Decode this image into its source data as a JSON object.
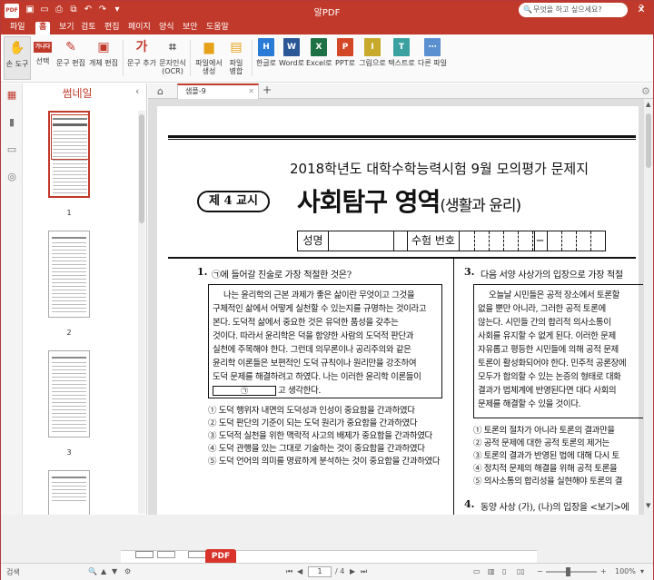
{
  "app": {
    "title": "알PDF",
    "logo": "PDF"
  },
  "window_controls": {
    "minimize": "─",
    "maximize": "☐",
    "close": "✕"
  },
  "quick_access": [
    "save-icon",
    "open-icon",
    "print-icon",
    "copy-icon",
    "undo-icon",
    "redo-icon",
    "dropdown-icon"
  ],
  "menus": [
    {
      "label": "파일",
      "active": false
    },
    {
      "label": "홈",
      "active": true
    },
    {
      "label": "보기",
      "active": false
    },
    {
      "label": "검토",
      "active": false
    },
    {
      "label": "편집",
      "active": false
    },
    {
      "label": "페이지",
      "active": false
    },
    {
      "label": "양식",
      "active": false
    },
    {
      "label": "보안",
      "active": false
    },
    {
      "label": "도움말",
      "active": false
    }
  ],
  "search": {
    "placeholder": "무엇을 하고 싶으세요?"
  },
  "ribbon": {
    "tools": [
      {
        "label": "손 도구",
        "icon": "hand-icon",
        "glyph": "✋",
        "color": "#555555",
        "selected": true
      },
      {
        "label": "선택",
        "icon": "select-icon",
        "glyph": "가나다",
        "color": "#c0392b"
      },
      {
        "label": "문구 편집",
        "icon": "text-edit-icon",
        "glyph": "✎",
        "color": "#c0392b"
      },
      {
        "label": "개체 편집",
        "icon": "object-edit-icon",
        "glyph": "▣",
        "color": "#c0392b"
      },
      {
        "label": "문구 추가",
        "icon": "add-text-icon",
        "glyph": "가",
        "color": "#c0392b"
      },
      {
        "label": "문자인식\n(OCR)",
        "icon": "ocr-icon",
        "glyph": "⌗",
        "color": "#555555"
      },
      {
        "label": "파일에서\n생성",
        "icon": "create-from-file-icon",
        "glyph": "▆",
        "color": "#e6a21a"
      },
      {
        "label": "파일\n병합",
        "icon": "merge-icon",
        "glyph": "▤",
        "color": "#e6a21a"
      }
    ],
    "converts": [
      {
        "label": "한글로",
        "letter": "H",
        "color": "#2a7bd5"
      },
      {
        "label": "Word로",
        "letter": "W",
        "color": "#2b5797"
      },
      {
        "label": "Excel로",
        "letter": "X",
        "color": "#1e7145"
      },
      {
        "label": "PPT로",
        "letter": "P",
        "color": "#d24726"
      },
      {
        "label": "그림으로",
        "letter": "I",
        "color": "#c7a92b"
      },
      {
        "label": "텍스트로",
        "letter": "T",
        "color": "#3aa0a0"
      },
      {
        "label": "다른 파일",
        "letter": "⋯",
        "color": "#5a8fd0"
      }
    ]
  },
  "sidebar": {
    "title": "썸네일",
    "pages": [
      "1",
      "2",
      "3"
    ]
  },
  "tabs": {
    "doc_tab": "샘플-9"
  },
  "document": {
    "exam_title": "2018학년도 대학수학능력시험 9월 모의평가 문제지",
    "session": "제 4 교시",
    "subject": "사회탐구 영역",
    "subject_sub": "(생활과 윤리)",
    "name_label": "성명",
    "id_label": "수험 번호",
    "q1": {
      "num": "1.",
      "text": "㉠에 들어갈 진술로 가장 적절한 것은?",
      "passage": [
        "나는 윤리학의 근본 과제가 좋은 삶이란 무엇이고 그것을",
        "구체적인 삶에서 어떻게 실천할 수 있는지를 규명하는 것이라고",
        "본다. 도덕적 삶에서 중요한 것은 유덕한 품성을 갖추는",
        "것이다. 따라서 윤리학은 덕을 함양한 사람의 도덕적 판단과",
        "실천에 주목해야 한다. 그런데 의무론이나 공리주의와 같은",
        "윤리학 이론들은 보편적인 도덕 규칙이나 원리만을 강조하여",
        "도덕 문제를 해결하려고 하였다. 나는 이러한 윤리학 이론들이"
      ],
      "blank_mark": "㉠",
      "passage_end": "고 생각한다.",
      "options": [
        "① 도덕 행위자 내면의 도덕성과 인성이 중요함을 간과하였다",
        "② 도덕 판단의 기준이 되는 도덕 원리가 중요함을 간과하였다",
        "③ 도덕적 실천을 위한 맥락적 사고의 배제가 중요함을 간과하였다",
        "④ 도덕 관행을 있는 그대로 기술하는 것이 중요함을 간과하였다",
        "⑤ 도덕 언어의 의미를 명료하게 분석하는 것이 중요함을 간과하였다"
      ]
    },
    "q3": {
      "num": "3.",
      "text": "다음 서양 사상가의 입장으로 가장 적절",
      "passage": [
        "오늘날 시민들은 공적 장소에서 토론할",
        "없을 뿐만 아니라, 그러한 공적 토론에",
        "않는다. 시민들 간의 합리적 의사소통이",
        "사회를 유지할 수 없게 된다. 이러한 문제",
        "자유롭고 평등한 시민들에 의해 공적 문제",
        "토론이 활성화되어야 한다. 민주적 공론장에",
        "모두가 합의할 수 있는 논증의 형태로 대화",
        "결과가 법체계에 반영된다면 대다 사회의",
        "문제를 해결할 수 있을 것이다."
      ],
      "options": [
        "① 토론의 절차가 아니라 토론의 결과만을",
        "② 공적 문제에 대한 공적 토론의 제거는",
        "③ 토론의 결과가 반영된 법에 대해 다시 토",
        "④ 정치적 문제의 해결을 위해 공적 토론을",
        "⑤ 의사소통의 합리성을 실현해야 토론의 결"
      ]
    },
    "q4": {
      "num": "4.",
      "text": "동양 사상 (가), (나)의 입장을 <보기>에"
    }
  },
  "popup": {
    "badge": "PDF"
  },
  "status": {
    "search_label": "검색",
    "page_current": "1",
    "page_total": "/ 4",
    "zoom": "100%"
  }
}
